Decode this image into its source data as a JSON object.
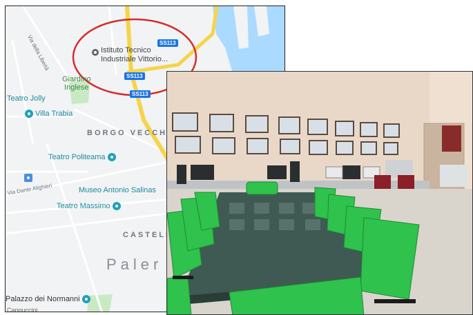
{
  "map": {
    "road_badges": [
      "SS113",
      "SS113",
      "SS113"
    ],
    "pin_label_line1": "Istituto Tecnico",
    "pin_label_line2": "Industriale Vittorio...",
    "places": {
      "giardino": "Giardino\nInglese",
      "teatro_jolly": "Teatro Jolly",
      "villa_trabia": "Villa Trabia",
      "borgo_vecchio": "BORGO VECCHI",
      "teatro_politeama": "Teatro Politeama",
      "museo": "Museo Antonio Salinas",
      "teatro_massimo": "Teatro Massimo",
      "castell": "CASTELL",
      "palermo": "Paler",
      "palazzo": "Palazzo dei Normanni",
      "cappuccini": "Cappuccini"
    },
    "streets": {
      "via_liberta": "Via della Libertà",
      "via_dante": "Via Dante Alighieri"
    },
    "colors": {
      "highlight_circle": "#d62b2b",
      "water": "#aadaff",
      "road_major": "#f6d44a",
      "poi_text": "#1f8a9e"
    }
  },
  "photo": {
    "colors": {
      "chairs": "#2fc24c",
      "wall": "#e9d8c8",
      "table_glass": "#3e5a52"
    }
  }
}
